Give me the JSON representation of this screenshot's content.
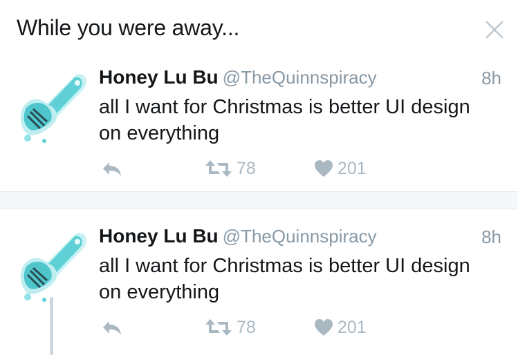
{
  "header": {
    "title": "While you were away..."
  },
  "tweets": [
    {
      "name": "Honey Lu Bu",
      "handle": "@TheQuinnspiracy",
      "time": "8h",
      "text": "all I want for Christmas is better UI design on everything",
      "retweets": "78",
      "likes": "201"
    },
    {
      "name": "Honey Lu Bu",
      "handle": "@TheQuinnspiracy",
      "time": "8h",
      "text": "all I want for Christmas is better UI design on everything",
      "retweets": "78",
      "likes": "201"
    }
  ],
  "colors": {
    "text": "#14171a",
    "secondary": "#8899a6",
    "action_gray": "#aab8c2",
    "avatar_teal": "#5fd1d6",
    "divider": "#e1e8ed"
  },
  "icons": [
    "close-icon",
    "reply-icon",
    "retweet-icon",
    "heart-icon"
  ]
}
